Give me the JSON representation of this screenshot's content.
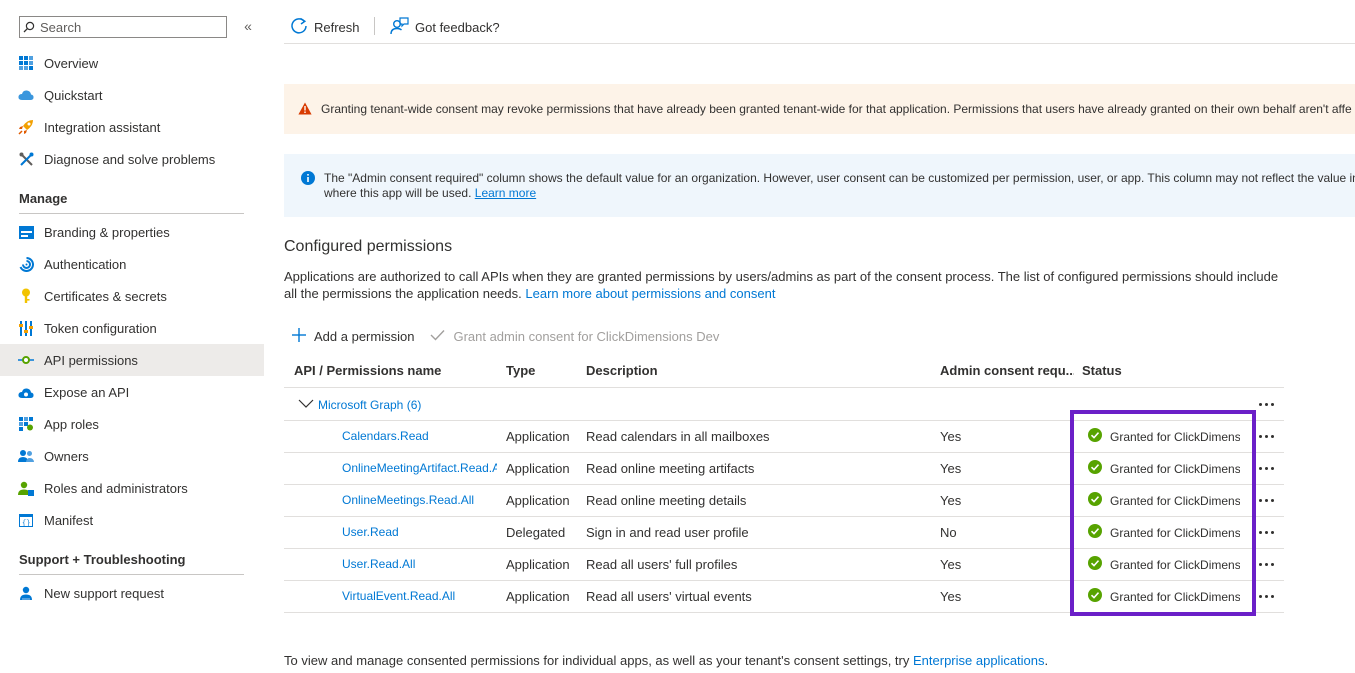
{
  "sidebar": {
    "search_placeholder": "Search",
    "collapse_icon": "double-chevron-left-icon",
    "items_top": [
      {
        "label": "Overview",
        "icon": "grid-icon"
      },
      {
        "label": "Quickstart",
        "icon": "cloud-icon"
      },
      {
        "label": "Integration assistant",
        "icon": "rocket-icon"
      },
      {
        "label": "Diagnose and solve problems",
        "icon": "wrench-icon"
      }
    ],
    "manage_header": "Manage",
    "manage_items": [
      {
        "label": "Branding & properties",
        "icon": "branding-icon"
      },
      {
        "label": "Authentication",
        "icon": "authentication-icon"
      },
      {
        "label": "Certificates & secrets",
        "icon": "key-icon"
      },
      {
        "label": "Token configuration",
        "icon": "token-icon"
      },
      {
        "label": "API permissions",
        "icon": "api-icon",
        "active": true
      },
      {
        "label": "Expose an API",
        "icon": "cloud-api-icon"
      },
      {
        "label": "App roles",
        "icon": "app-roles-icon"
      },
      {
        "label": "Owners",
        "icon": "owners-icon"
      },
      {
        "label": "Roles and administrators",
        "icon": "roles-icon"
      },
      {
        "label": "Manifest",
        "icon": "manifest-icon"
      }
    ],
    "support_header": "Support + Troubleshooting",
    "support_items": [
      {
        "label": "New support request",
        "icon": "support-icon"
      }
    ]
  },
  "toolbar": {
    "refresh_label": "Refresh",
    "feedback_label": "Got feedback?"
  },
  "warning_banner": {
    "text": "Granting tenant-wide consent may revoke permissions that have already been granted tenant-wide for that application. Permissions that users have already granted on their own behalf aren't affe"
  },
  "info_banner": {
    "line1": "The \"Admin consent required\" column shows the default value for an organization. However, user consent can be customized per permission, user, or app. This column may not reflect the value in",
    "line2": "where this app will be used.",
    "link": "Learn more"
  },
  "configured": {
    "title": "Configured permissions",
    "desc_line1": "Applications are authorized to call APIs when they are granted permissions by users/admins as part of the consent process. The list of configured permissions should include",
    "desc_line2": "all the permissions the application needs.",
    "desc_link": "Learn more about permissions and consent"
  },
  "actions": {
    "add_label": "Add a permission",
    "grant_label": "Grant admin consent for ClickDimensions Dev"
  },
  "table": {
    "headers": [
      "API / Permissions name",
      "Type",
      "Description",
      "Admin consent requ...",
      "Status"
    ],
    "group_label": "Microsoft Graph (6)",
    "rows": [
      {
        "name": "Calendars.Read",
        "type": "Application",
        "description": "Read calendars in all mailboxes",
        "admin": "Yes",
        "status": "Granted for ClickDimens..."
      },
      {
        "name": "OnlineMeetingArtifact.Read.All",
        "type": "Application",
        "description": "Read online meeting artifacts",
        "admin": "Yes",
        "status": "Granted for ClickDimens..."
      },
      {
        "name": "OnlineMeetings.Read.All",
        "type": "Application",
        "description": "Read online meeting details",
        "admin": "Yes",
        "status": "Granted for ClickDimens..."
      },
      {
        "name": "User.Read",
        "type": "Delegated",
        "description": "Sign in and read user profile",
        "admin": "No",
        "status": "Granted for ClickDimens..."
      },
      {
        "name": "User.Read.All",
        "type": "Application",
        "description": "Read all users' full profiles",
        "admin": "Yes",
        "status": "Granted for ClickDimens..."
      },
      {
        "name": "VirtualEvent.Read.All",
        "type": "Application",
        "description": "Read all users' virtual events",
        "admin": "Yes",
        "status": "Granted for ClickDimens..."
      }
    ]
  },
  "footer": {
    "text": "To view and manage consented permissions for individual apps, as well as your tenant's consent settings, try",
    "link": "Enterprise applications",
    "suffix": "."
  },
  "colors": {
    "accent": "#0078d4",
    "success": "#57a300",
    "highlight": "#6b1fc8",
    "warning_bg": "#fdf3e8",
    "info_bg": "#eff6fc"
  }
}
